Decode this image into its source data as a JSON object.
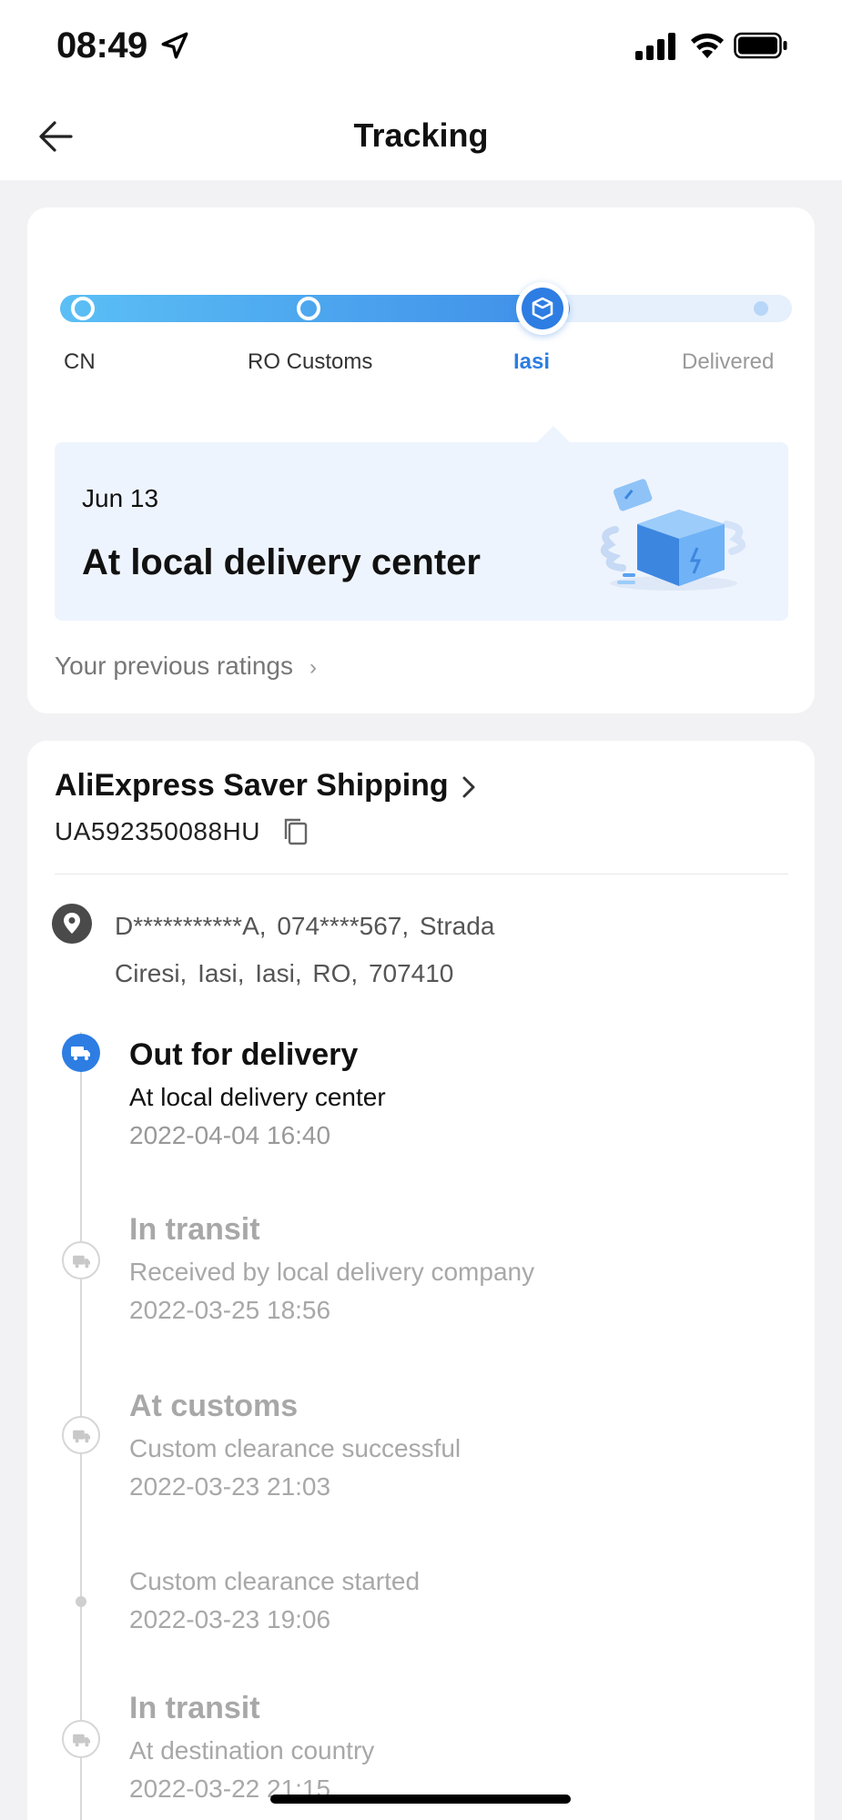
{
  "status_bar": {
    "time": "08:49"
  },
  "nav": {
    "title": "Tracking"
  },
  "progress": {
    "stages": [
      {
        "label": "CN",
        "state": "done"
      },
      {
        "label": "RO Customs",
        "state": "done"
      },
      {
        "label": "Iasi",
        "state": "current"
      },
      {
        "label": "Delivered",
        "state": "future"
      }
    ],
    "accent_color": "#2d7de3"
  },
  "status_box": {
    "date": "Jun 13",
    "text": "At local delivery center"
  },
  "previous_ratings": {
    "label": "Your previous ratings",
    "chevron": "›"
  },
  "shipping": {
    "method": "AliExpress Saver Shipping",
    "tracking_number": "UA592350088HU",
    "address_line1": "D***********A,  074****567,  Strada",
    "address_line2": "Ciresi,  Iasi,  Iasi,  RO,  707410"
  },
  "timeline": [
    {
      "title": "Out for delivery",
      "desc": "At local delivery center",
      "time": "2022-04-04 16:40",
      "state": "active",
      "icon": "truck-icon"
    },
    {
      "title": "In transit",
      "desc": "Received by local delivery company",
      "time": "2022-03-25 18:56",
      "state": "muted",
      "icon": "truck-icon"
    },
    {
      "title": "At customs",
      "desc": "Custom clearance successful",
      "time": "2022-03-23 21:03",
      "state": "muted",
      "icon": "truck-icon"
    },
    {
      "title": "",
      "desc": "Custom clearance started",
      "time": "2022-03-23 19:06",
      "state": "muted",
      "icon": "dot"
    },
    {
      "title": "In transit",
      "desc": "At destination country",
      "time": "2022-03-22 21:15",
      "state": "muted",
      "icon": "truck-icon"
    }
  ]
}
